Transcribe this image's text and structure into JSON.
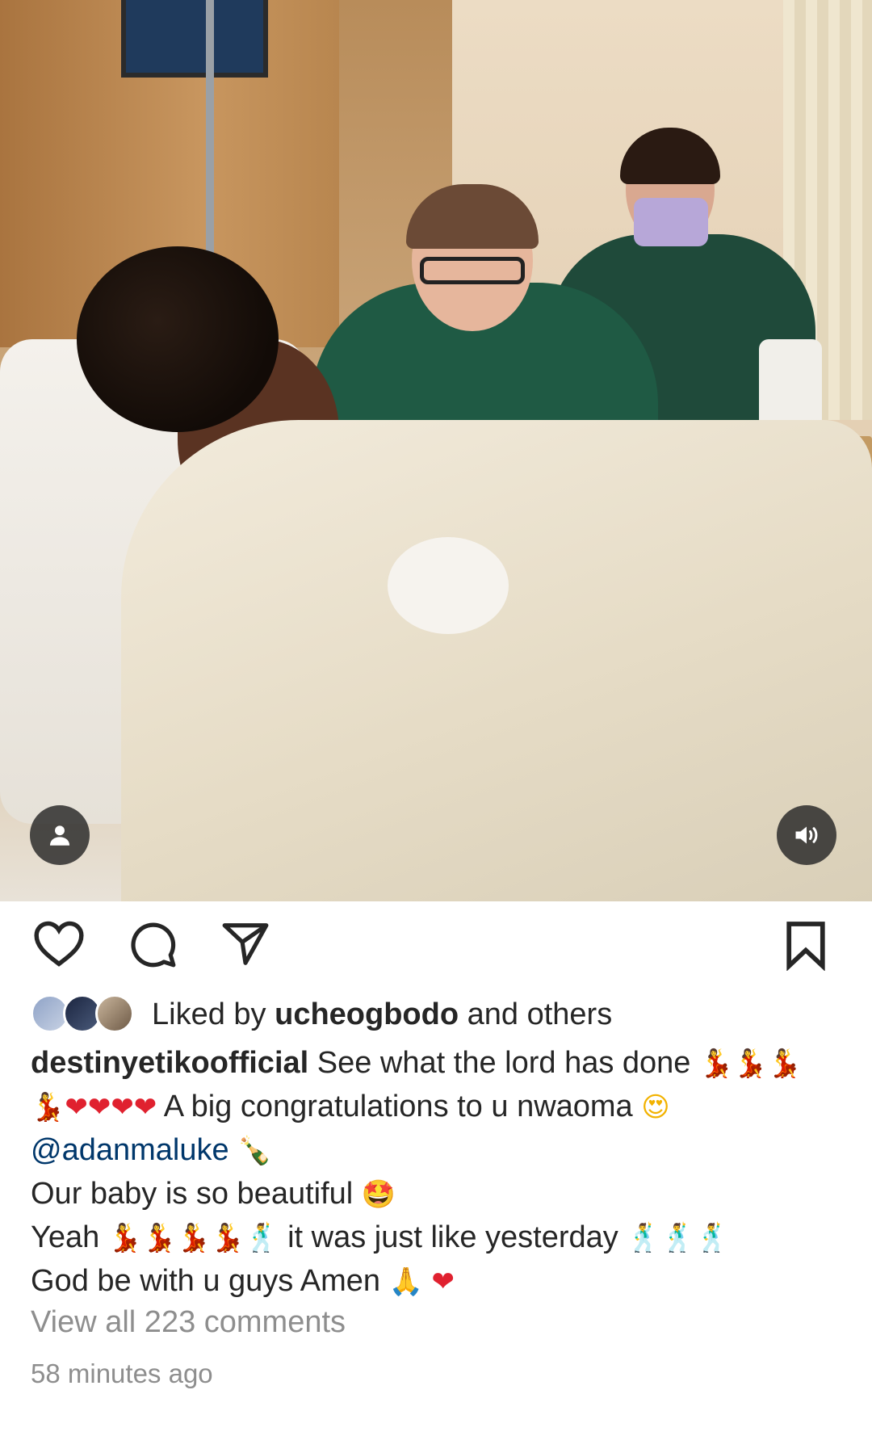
{
  "post": {
    "photo_alt": "",
    "liked_by": {
      "prefix": "Liked by",
      "user": "ucheogbodo",
      "suffix": "and others"
    },
    "caption": {
      "username": "destinyetikoofficial",
      "line1_text": "See what the lord has done",
      "line2_text": "A big congratulations to u nwaoma",
      "mention": "@adanmaluke",
      "line4_text": "Our baby is so beautiful",
      "line5_start": "Yeah",
      "line5_text": "it was just like yesterday",
      "line6_text": "God be with u guys Amen"
    },
    "view_all_comments": "View all 223 comments",
    "timestamp": "58 minutes ago"
  },
  "icons": {
    "like": "heart-icon",
    "comment": "comment-icon",
    "share": "send-icon",
    "save": "bookmark-icon",
    "tag_user": "user-icon",
    "sound": "volume-icon"
  },
  "colors": {
    "text": "#262626",
    "secondary_text": "#8e8e8e",
    "mention": "#00376b",
    "overlay_button": "#262626"
  }
}
